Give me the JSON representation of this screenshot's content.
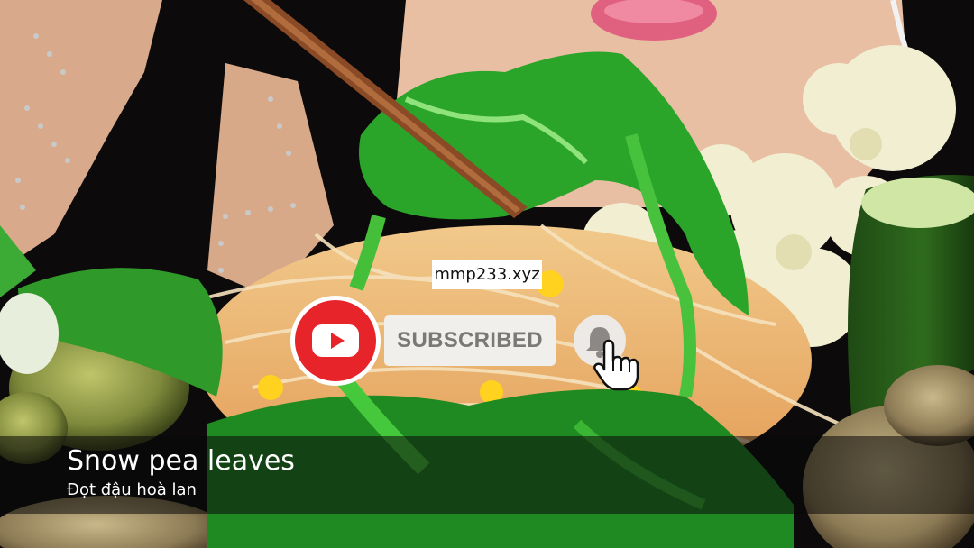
{
  "overlay": {
    "watermark": "mmp233.xyz",
    "subscribe_label": "SUBSCRIBED",
    "logo_icon": "youtube-logo-icon",
    "bell_icon": "bell-icon",
    "cursor_icon": "hand-pointer-icon"
  },
  "caption": {
    "title": "Snow pea leaves",
    "subtitle": "Đọt đậu hoà lan"
  },
  "colors": {
    "youtube_red": "#e8242b",
    "button_bg": "#f1efec",
    "button_text": "#7b7976"
  }
}
